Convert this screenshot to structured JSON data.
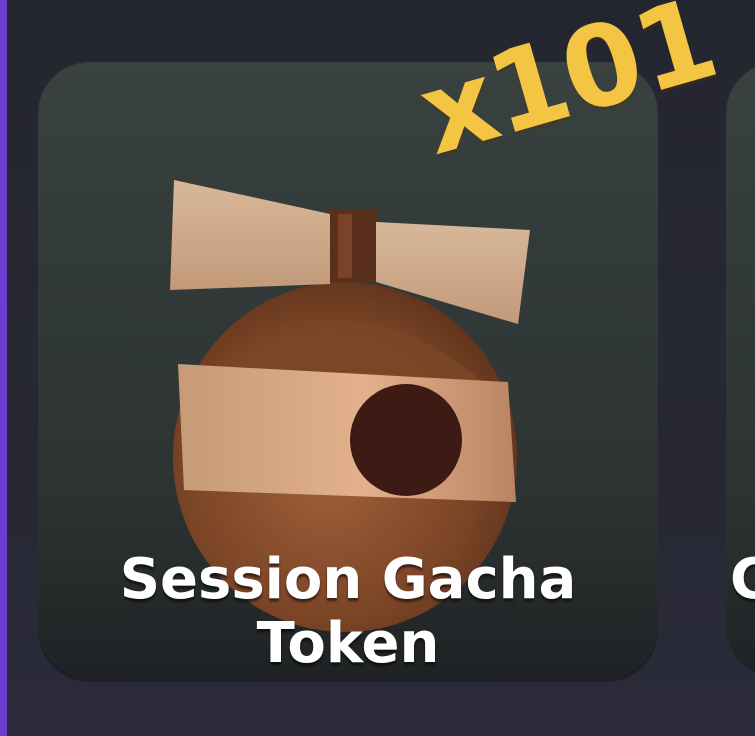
{
  "inventory": {
    "accent_color": "#6a3fd0",
    "slots": [
      {
        "name_line1": "Session Gacha",
        "name_line2": "Token",
        "quantity": "x101",
        "icon": "propeller-acorn-token-icon",
        "quantity_color": "#f4c443"
      },
      {
        "name_partial": "C"
      }
    ]
  }
}
